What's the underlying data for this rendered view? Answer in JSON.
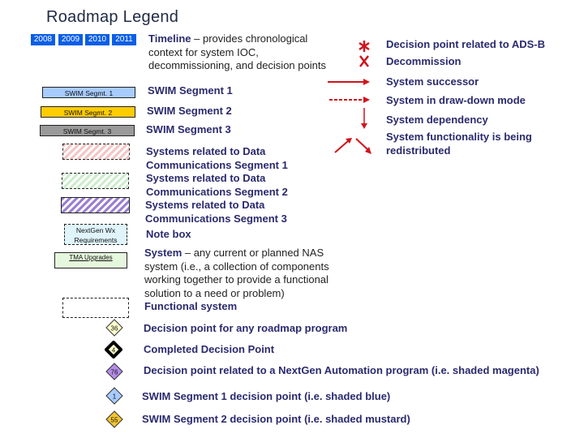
{
  "title": "Roadmap Legend",
  "timeline": {
    "years": [
      "2008",
      "2009",
      "2010",
      "2011"
    ],
    "label": "Timeline",
    "description": " – provides chronological context for system IOC, decommissioning, and decision points"
  },
  "segments": [
    {
      "box": "SWIM Segmt. 1",
      "label": "SWIM Segment 1",
      "color": "#a8ccff"
    },
    {
      "box": "SWIM Segmt. 2",
      "label": "SWIM Segment 2",
      "color": "#ffcc00"
    },
    {
      "box": "SWIM Segmt. 3",
      "label": "SWIM Segment 3",
      "color": "#9a9a9a"
    }
  ],
  "data_comm": [
    {
      "label": "Systems related to Data Communications Segment 1",
      "color": "#f3c6c6"
    },
    {
      "label": "Systems related to Data Communications Segment 2",
      "color": "#cdeccd"
    },
    {
      "label": "Systems related to Data Communications Segment 3",
      "color": "#9b7fd0"
    }
  ],
  "note_box": {
    "box": "NextGen Wx Requirements",
    "label": "Note box",
    "color": "#dff4fb"
  },
  "system": {
    "box": "TMA Upgrades",
    "label": "System",
    "description": " – any current or planned NAS system (i.e., a collection of components working together to provide a functional solution to a need or problem)",
    "color": "#e5f7dc"
  },
  "functional_system": {
    "label": "Functional system"
  },
  "symbols": [
    {
      "icon": "asterisk",
      "label": "Decision point related to ADS-B"
    },
    {
      "icon": "x-mark",
      "label": "Decommission"
    },
    {
      "icon": "solid-arrow",
      "label": "System successor"
    },
    {
      "icon": "dashed-arrow",
      "label": "System in draw-down mode"
    },
    {
      "icon": "down-arrow",
      "label": "System dependency"
    },
    {
      "icon": "split-arrows",
      "label": "System functionality is being redistributed"
    }
  ],
  "decision_points": [
    {
      "number": "36",
      "label": "Decision point for any roadmap program",
      "fill": "#ffffcc",
      "completed": false
    },
    {
      "number": "4",
      "label": "Completed Decision Point",
      "fill": "#ffffcc",
      "completed": true
    },
    {
      "number": "76",
      "label": "Decision point related to a NextGen Automation program (i.e. shaded magenta)",
      "fill": "#b48ce8",
      "completed": false
    },
    {
      "number": "1",
      "label": "SWIM Segment 1 decision point (i.e. shaded blue)",
      "fill": "#a8ccff",
      "completed": false
    },
    {
      "number": "55",
      "label": "SWIM Segment 2 decision point (i.e. shaded mustard)",
      "fill": "#f2c431",
      "completed": false
    }
  ],
  "colors": {
    "label_text": "#2a2a6e",
    "arrow_red": "#d0141c",
    "year_blue": "#0a5ee6"
  }
}
